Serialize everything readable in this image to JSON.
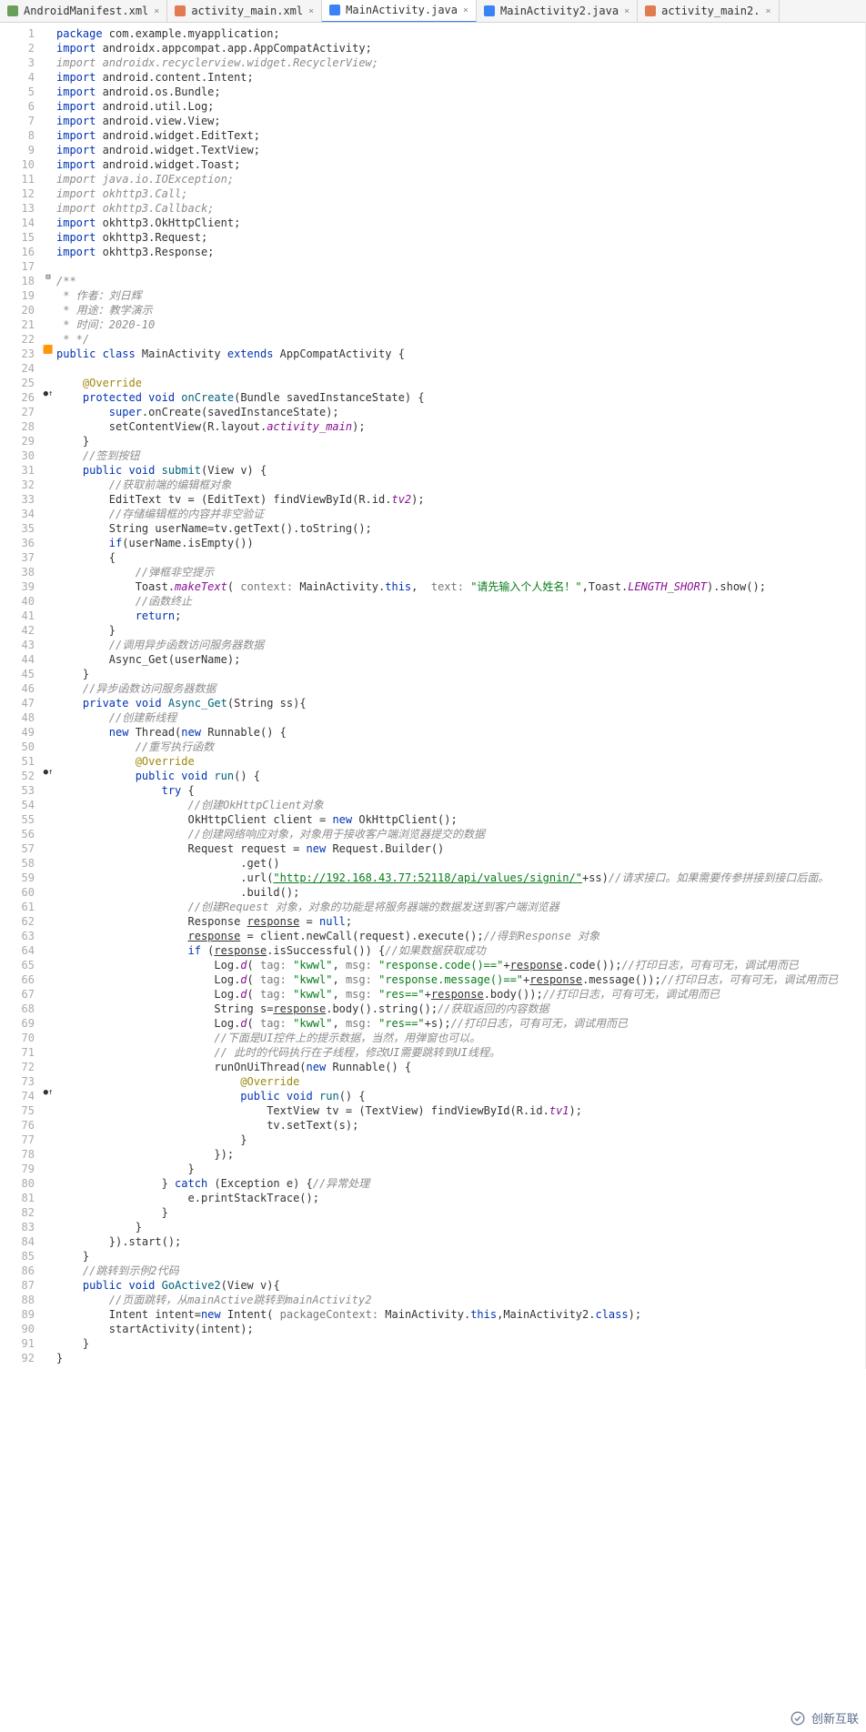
{
  "tabs": [
    {
      "icon_color": "#6a9f58",
      "name": "AndroidManifest.xml",
      "active": false
    },
    {
      "icon_color": "#e07b53",
      "name": "activity_main.xml",
      "active": false
    },
    {
      "icon_color": "#3b82f6",
      "name": "MainActivity.java",
      "active": true
    },
    {
      "icon_color": "#3b82f6",
      "name": "MainActivity2.java",
      "active": false
    },
    {
      "icon_color": "#e07b53",
      "name": "activity_main2.",
      "active": false
    }
  ],
  "gutter_marks": {
    "18": "⊟",
    "23": "🟧",
    "26": "●↑",
    "52": "●↑",
    "74": "●↑"
  },
  "code_lines": [
    {
      "n": 1,
      "html": "<span class='kw'>package</span> com.example.myapplication;"
    },
    {
      "n": 2,
      "html": "<span class='kw'>import</span> androidx.appcompat.app.AppCompatActivity;"
    },
    {
      "n": 3,
      "html": "<span class='com'>import androidx.recyclerview.widget.RecyclerView;</span>"
    },
    {
      "n": 4,
      "html": "<span class='kw'>import</span> android.content.Intent;"
    },
    {
      "n": 5,
      "html": "<span class='kw'>import</span> android.os.Bundle;"
    },
    {
      "n": 6,
      "html": "<span class='kw'>import</span> android.util.Log;"
    },
    {
      "n": 7,
      "html": "<span class='kw'>import</span> android.view.View;"
    },
    {
      "n": 8,
      "html": "<span class='kw'>import</span> android.widget.EditText;"
    },
    {
      "n": 9,
      "html": "<span class='kw'>import</span> android.widget.TextView;"
    },
    {
      "n": 10,
      "html": "<span class='kw'>import</span> android.widget.Toast;"
    },
    {
      "n": 11,
      "html": "<span class='com'>import java.io.IOException;</span>"
    },
    {
      "n": 12,
      "html": "<span class='com'>import okhttp3.Call;</span>"
    },
    {
      "n": 13,
      "html": "<span class='com'>import okhttp3.Callback;</span>"
    },
    {
      "n": 14,
      "html": "<span class='kw'>import</span> okhttp3.OkHttpClient;"
    },
    {
      "n": 15,
      "html": "<span class='kw'>import</span> okhttp3.Request;"
    },
    {
      "n": 16,
      "html": "<span class='kw'>import</span> okhttp3.Response;"
    },
    {
      "n": 17,
      "html": ""
    },
    {
      "n": 18,
      "html": "<span class='com'>/**</span>"
    },
    {
      "n": 19,
      "html": "<span class='com'> * 作者：刘日辉</span>"
    },
    {
      "n": 20,
      "html": "<span class='com'> * 用途：教学演示</span>"
    },
    {
      "n": 21,
      "html": "<span class='com'> * 时间：2020-10</span>"
    },
    {
      "n": 22,
      "html": "<span class='com'> * */</span>"
    },
    {
      "n": 23,
      "html": "<span class='kw'>public class</span> MainActivity <span class='kw'>extends</span> AppCompatActivity {"
    },
    {
      "n": 24,
      "html": ""
    },
    {
      "n": 25,
      "html": "    <span class='ann'>@Override</span>"
    },
    {
      "n": 26,
      "html": "    <span class='kw'>protected void</span> <span class='fn'>onCreate</span>(Bundle savedInstanceState) {"
    },
    {
      "n": 27,
      "html": "        <span class='kw'>super</span>.onCreate(savedInstanceState);"
    },
    {
      "n": 28,
      "html": "        setContentView(R.layout.<span class='fld'>activity_main</span>);"
    },
    {
      "n": 29,
      "html": "    }"
    },
    {
      "n": 30,
      "html": "    <span class='com'>//签到按钮</span>"
    },
    {
      "n": 31,
      "html": "    <span class='kw'>public void</span> <span class='fn'>submit</span>(View v) {"
    },
    {
      "n": 32,
      "html": "        <span class='com'>//获取前端的编辑框对象</span>"
    },
    {
      "n": 33,
      "html": "        EditText tv = (EditText) findViewById(R.id.<span class='fld'>tv2</span>);"
    },
    {
      "n": 34,
      "html": "        <span class='com'>//存储编辑框的内容并非空验证</span>"
    },
    {
      "n": 35,
      "html": "        String userName=tv.getText().toString();"
    },
    {
      "n": 36,
      "html": "        <span class='kw'>if</span>(userName.isEmpty())"
    },
    {
      "n": 37,
      "html": "        {"
    },
    {
      "n": 38,
      "html": "            <span class='com'>//弹框非空提示</span>"
    },
    {
      "n": 39,
      "html": "            Toast.<span class='fld'>makeText</span>( <span class='hint'>context:</span> MainActivity.<span class='kw'>this</span>,  <span class='hint'>text:</span> <span class='str'>\"请先输入个人姓名！\"</span>,Toast.<span class='fld'>LENGTH_SHORT</span>).show();"
    },
    {
      "n": 40,
      "html": "            <span class='com'>//函数终止</span>"
    },
    {
      "n": 41,
      "html": "            <span class='kw'>return</span>;"
    },
    {
      "n": 42,
      "html": "        }"
    },
    {
      "n": 43,
      "html": "        <span class='com'>//调用异步函数访问服务器数据</span>"
    },
    {
      "n": 44,
      "html": "        Async_Get(userName);"
    },
    {
      "n": 45,
      "html": "    }"
    },
    {
      "n": 46,
      "html": "    <span class='com'>//异步函数访问服务器数据</span>"
    },
    {
      "n": 47,
      "html": "    <span class='kw'>private void</span> <span class='fn'>Async_Get</span>(String ss){"
    },
    {
      "n": 48,
      "html": "        <span class='com'>//创建新线程</span>"
    },
    {
      "n": 49,
      "html": "        <span class='kw'>new</span> Thread(<span class='kw'>new</span> Runnable() {"
    },
    {
      "n": 50,
      "html": "            <span class='com'>//重写执行函数</span>"
    },
    {
      "n": 51,
      "html": "            <span class='ann'>@Override</span>"
    },
    {
      "n": 52,
      "html": "            <span class='kw'>public void</span> <span class='fn'>run</span>() {"
    },
    {
      "n": 53,
      "html": "                <span class='kw'>try</span> {"
    },
    {
      "n": 54,
      "html": "                    <span class='com'>//创建OkHttpClient对象</span>"
    },
    {
      "n": 55,
      "html": "                    OkHttpClient client = <span class='kw'>new</span> OkHttpClient();"
    },
    {
      "n": 56,
      "html": "                    <span class='com'>//创建网络响应对象，对象用于接收客户端浏览器提交的数据</span>"
    },
    {
      "n": 57,
      "html": "                    Request request = <span class='kw'>new</span> Request.Builder()"
    },
    {
      "n": 58,
      "html": "                            .get()"
    },
    {
      "n": 59,
      "html": "                            .url(<span class='url'>\"http://192.168.43.77:52118/api/values/signin/\"</span>+ss)<span class='com'>//请求接口。如果需要传参拼接到接口后面。</span>"
    },
    {
      "n": 60,
      "html": "                            .build();"
    },
    {
      "n": 61,
      "html": "                    <span class='com'>//创建Request 对象，对象的功能是将服务器端的数据发送到客户端浏览器</span>"
    },
    {
      "n": 62,
      "html": "                    Response <u>response</u> = <span class='kw'>null</span>;"
    },
    {
      "n": 63,
      "html": "                    <u>response</u> = client.newCall(request).execute();<span class='com'>//得到Response 对象</span>"
    },
    {
      "n": 64,
      "html": "                    <span class='kw'>if</span> (<u>response</u>.isSuccessful()) {<span class='com'>//如果数据获取成功</span>"
    },
    {
      "n": 65,
      "html": "                        Log.<span class='fld'>d</span>( <span class='hint'>tag:</span> <span class='str'>\"kwwl\"</span>, <span class='hint'>msg:</span> <span class='str'>\"response.code()==\"</span>+<u>response</u>.code());<span class='com'>//打印日志，可有可无，调试用而已</span>"
    },
    {
      "n": 66,
      "html": "                        Log.<span class='fld'>d</span>( <span class='hint'>tag:</span> <span class='str'>\"kwwl\"</span>, <span class='hint'>msg:</span> <span class='str'>\"response.message()==\"</span>+<u>response</u>.message());<span class='com'>//打印日志，可有可无，调试用而已</span>"
    },
    {
      "n": 67,
      "html": "                        Log.<span class='fld'>d</span>( <span class='hint'>tag:</span> <span class='str'>\"kwwl\"</span>, <span class='hint'>msg:</span> <span class='str'>\"res==\"</span>+<u>response</u>.body());<span class='com'>//打印日志，可有可无，调试用而已</span>"
    },
    {
      "n": 68,
      "html": "                        String s=<u>response</u>.body().string();<span class='com'>//获取返回的内容数据</span>"
    },
    {
      "n": 69,
      "html": "                        Log.<span class='fld'>d</span>( <span class='hint'>tag:</span> <span class='str'>\"kwwl\"</span>, <span class='hint'>msg:</span> <span class='str'>\"res==\"</span>+s);<span class='com'>//打印日志，可有可无，调试用而已</span>"
    },
    {
      "n": 70,
      "html": "                        <span class='com'>//下面是UI控件上的提示数据，当然，用弹窗也可以。</span>"
    },
    {
      "n": 71,
      "html": "                        <span class='com'>// 此时的代码执行在子线程，修改UI需要跳转到UI线程。</span>"
    },
    {
      "n": 72,
      "html": "                        runOnUiThread(<span class='kw'>new</span> Runnable() {"
    },
    {
      "n": 73,
      "html": "                            <span class='ann'>@Override</span>"
    },
    {
      "n": 74,
      "html": "                            <span class='kw'>public void</span> <span class='fn'>run</span>() {"
    },
    {
      "n": 75,
      "html": "                                TextView tv = (TextView) findViewById(R.id.<span class='fld'>tv1</span>);"
    },
    {
      "n": 76,
      "html": "                                tv.setText(s);"
    },
    {
      "n": 77,
      "html": "                            }"
    },
    {
      "n": 78,
      "html": "                        });"
    },
    {
      "n": 79,
      "html": "                    }"
    },
    {
      "n": 80,
      "html": "                } <span class='kw'>catch</span> (Exception e) {<span class='com'>//异常处理</span>"
    },
    {
      "n": 81,
      "html": "                    e.printStackTrace();"
    },
    {
      "n": 82,
      "html": "                }"
    },
    {
      "n": 83,
      "html": "            }"
    },
    {
      "n": 84,
      "html": "        }).start();"
    },
    {
      "n": 85,
      "html": "    }"
    },
    {
      "n": 86,
      "html": "    <span class='com'>//跳转到示例2代码</span>"
    },
    {
      "n": 87,
      "html": "    <span class='kw'>public void</span> <span class='fn'>GoActive2</span>(View v){"
    },
    {
      "n": 88,
      "html": "        <span class='com'>//页面跳转，从mainActive跳转到mainActivity2</span>"
    },
    {
      "n": 89,
      "html": "        Intent intent=<span class='kw'>new</span> Intent( <span class='hint'>packageContext:</span> MainActivity.<span class='kw'>this</span>,MainActivity2.<span class='kw'>class</span>);"
    },
    {
      "n": 90,
      "html": "        startActivity(intent);"
    },
    {
      "n": 91,
      "html": "    }"
    },
    {
      "n": 92,
      "html": "}"
    }
  ],
  "watermark": "创新互联"
}
